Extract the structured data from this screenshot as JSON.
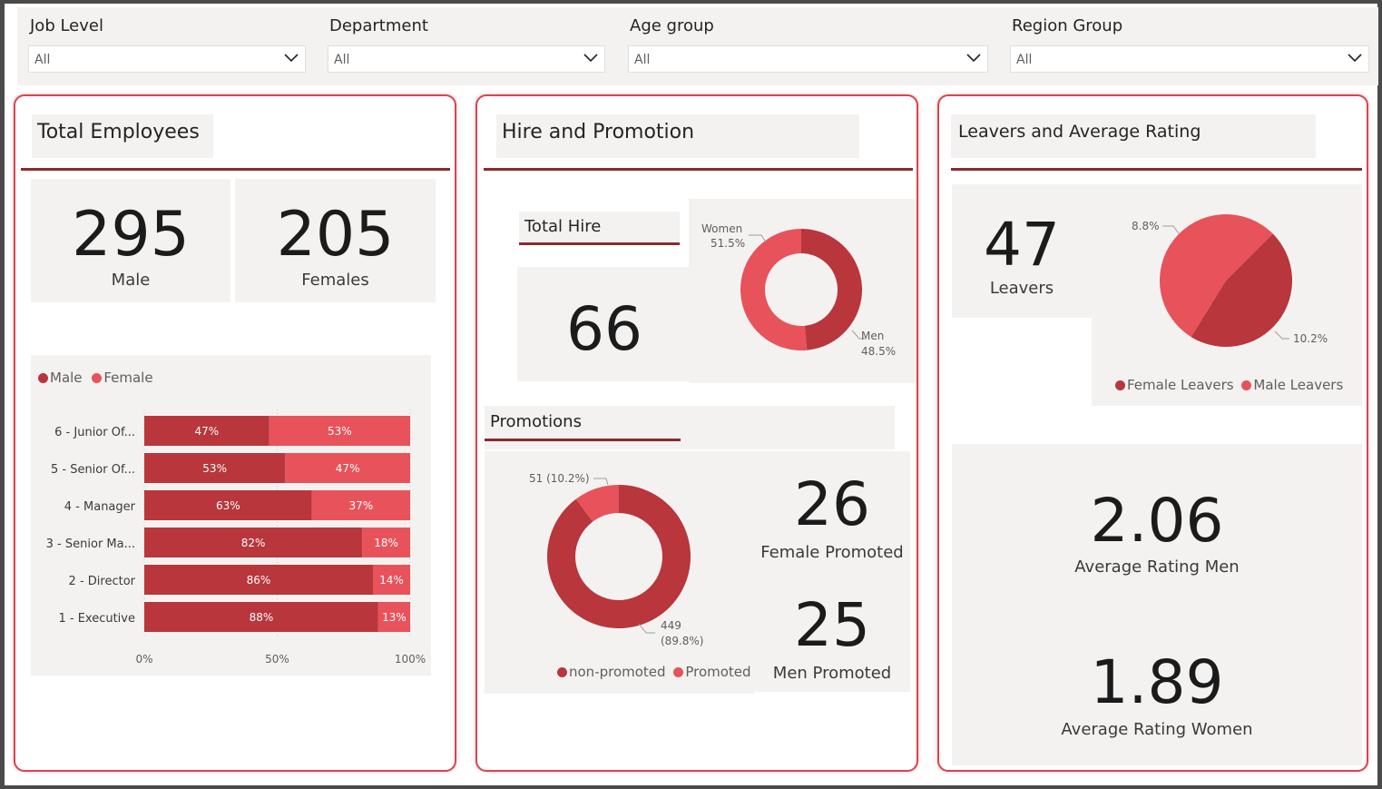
{
  "colors": {
    "male": "#b8363c",
    "female": "#e8525a",
    "accent_border": "#d64550",
    "rule": "#8b2a2e"
  },
  "filters": [
    {
      "label": "Job Level",
      "value": "All"
    },
    {
      "label": "Department",
      "value": "All"
    },
    {
      "label": "Age group",
      "value": "All"
    },
    {
      "label": "Region Group",
      "value": "All"
    }
  ],
  "total_employees": {
    "title": "Total Employees",
    "male_count": "295",
    "male_label": "Male",
    "female_count": "205",
    "female_label": "Females",
    "legend": [
      "Male",
      "Female"
    ]
  },
  "hire_promotion": {
    "title": "Hire and Promotion",
    "total_hire_title": "Total Hire",
    "total_hire_value": "66",
    "promotions_title": "Promotions",
    "female_promoted_value": "26",
    "female_promoted_label": "Female Promoted",
    "men_promoted_value": "25",
    "men_promoted_label": "Men Promoted",
    "promo_legend": [
      "non-promoted",
      "Promoted"
    ]
  },
  "leavers": {
    "title": "Leavers and Average Rating",
    "leavers_value": "47",
    "leavers_label": "Leavers",
    "legend": [
      "Female Leavers",
      "Male Leavers"
    ],
    "avg_men_value": "2.06",
    "avg_men_label": "Average Rating Men",
    "avg_women_value": "1.89",
    "avg_women_label": "Average Rating Women"
  },
  "chart_data": [
    {
      "type": "bar",
      "orientation": "horizontal-stacked-100",
      "categories": [
        "6 - Junior Of...",
        "5 - Senior Of...",
        "4 - Manager",
        "3 - Senior Ma...",
        "2 - Director",
        "1 - Executive"
      ],
      "series": [
        {
          "name": "Male",
          "values": [
            47,
            53,
            63,
            82,
            86,
            88
          ],
          "labels": [
            "47%",
            "53%",
            "63%",
            "82%",
            "86%",
            "88%"
          ]
        },
        {
          "name": "Female",
          "values": [
            53,
            47,
            37,
            18,
            14,
            13
          ],
          "labels": [
            "53%",
            "47%",
            "37%",
            "18%",
            "14%",
            "13%"
          ]
        }
      ],
      "x_ticks": [
        "0%",
        "50%",
        "100%"
      ],
      "xlim": [
        0,
        100
      ],
      "legend": "top-left",
      "grid": true
    },
    {
      "type": "pie",
      "variant": "donut",
      "slices": [
        {
          "name": "Women",
          "value": 51.5,
          "label": "51.5%"
        },
        {
          "name": "Men",
          "value": 48.5,
          "label": "48.5%"
        }
      ]
    },
    {
      "type": "pie",
      "variant": "donut",
      "slices": [
        {
          "name": "non-promoted",
          "value": 449,
          "label_line1": "449",
          "label_line2": "(89.8%)"
        },
        {
          "name": "Promoted",
          "value": 51,
          "label": "51 (10.2%)"
        }
      ],
      "legend": "bottom"
    },
    {
      "type": "pie",
      "slices": [
        {
          "name": "Female Leavers",
          "value": 8.8,
          "label": "8.8%"
        },
        {
          "name": "Male Leavers",
          "value": 10.2,
          "label": "10.2%"
        }
      ],
      "legend": "bottom"
    }
  ]
}
